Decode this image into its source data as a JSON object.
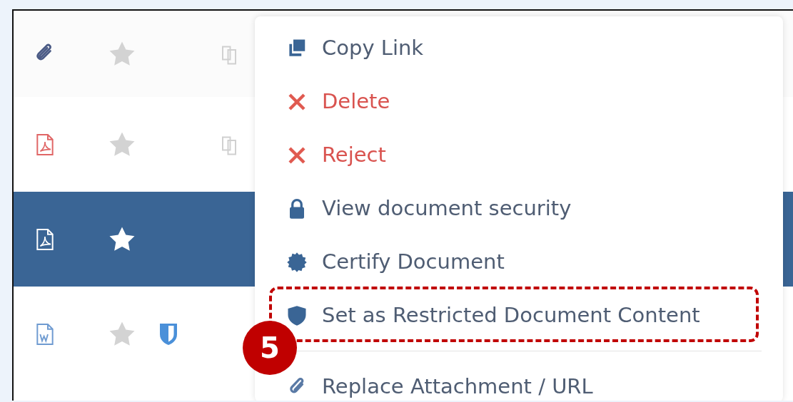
{
  "rows": [
    {
      "kind": "attachment",
      "starred": false,
      "selected": false,
      "linked": true,
      "restricted": false
    },
    {
      "kind": "pdf",
      "starred": false,
      "selected": false,
      "linked": true,
      "restricted": false
    },
    {
      "kind": "pdf",
      "starred": true,
      "selected": true,
      "linked": false,
      "restricted": false
    },
    {
      "kind": "word",
      "starred": false,
      "selected": false,
      "linked": false,
      "restricted": true
    }
  ],
  "menu": {
    "items": [
      {
        "kind": "copy",
        "label": "Copy Link",
        "highlighted": false
      },
      {
        "kind": "delete",
        "label": "Delete",
        "highlighted": false
      },
      {
        "kind": "reject",
        "label": "Reject",
        "highlighted": false
      },
      {
        "kind": "security",
        "label": "View document security",
        "highlighted": false
      },
      {
        "kind": "certify",
        "label": "Certify Document",
        "highlighted": false
      },
      {
        "kind": "restrict",
        "label": "Set as Restricted Document Content",
        "highlighted": true
      },
      {
        "kind": "divider"
      },
      {
        "kind": "replace",
        "label": "Replace Attachment / URL",
        "highlighted": false
      }
    ]
  },
  "callout": {
    "number": "5"
  }
}
